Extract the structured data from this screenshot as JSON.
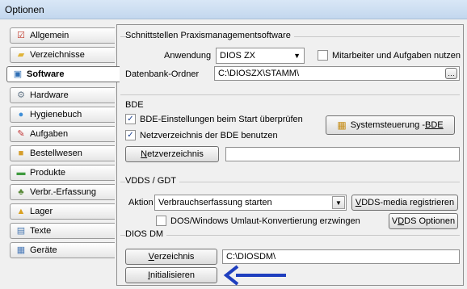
{
  "window": {
    "title": "Optionen"
  },
  "sidebar": {
    "items": [
      {
        "label": "Allgemein",
        "icon": "checklist-icon",
        "glyph": "☑",
        "color": "#c0392b"
      },
      {
        "label": "Verzeichnisse",
        "icon": "folder-icon",
        "glyph": "▰",
        "color": "#e0b43a"
      },
      {
        "label": "Software",
        "icon": "monitor-icon",
        "glyph": "▣",
        "color": "#2f6fb5"
      },
      {
        "label": "Hardware",
        "icon": "gear-icon",
        "glyph": "⚙",
        "color": "#6b7c8c"
      },
      {
        "label": "Hygienebuch",
        "icon": "globe-icon",
        "glyph": "●",
        "color": "#3f8fd8"
      },
      {
        "label": "Aufgaben",
        "icon": "tasks-icon",
        "glyph": "✎",
        "color": "#c03030"
      },
      {
        "label": "Bestellwesen",
        "icon": "box-icon",
        "glyph": "■",
        "color": "#d59d2b"
      },
      {
        "label": "Produkte",
        "icon": "products-icon",
        "glyph": "▬",
        "color": "#3f9a3f"
      },
      {
        "label": "Verbr.-Erfassung",
        "icon": "consumption-icon",
        "glyph": "♣",
        "color": "#5a8a3a"
      },
      {
        "label": "Lager",
        "icon": "warehouse-icon",
        "glyph": "▲",
        "color": "#d9a020"
      },
      {
        "label": "Texte",
        "icon": "document-icon",
        "glyph": "▤",
        "color": "#4a78b0"
      },
      {
        "label": "Geräte",
        "icon": "devices-icon",
        "glyph": "▦",
        "color": "#4a7ab8"
      }
    ],
    "active_index": 2
  },
  "schnittstellen": {
    "group_label": "Schnittstellen Praxismanagementsoftware",
    "anwendung_label": "Anwendung",
    "anwendung_value": "DIOS ZX",
    "mitarbeiter_label": "Mitarbeiter und Aufgaben nutzen",
    "mitarbeiter_checked": false,
    "datenbank_label": "Datenbank-Ordner",
    "datenbank_value": "C:\\DIOSZX\\STAMM\\",
    "browse_label": "…"
  },
  "bde": {
    "group_label": "BDE",
    "check1_label": "BDE-Einstellungen beim Start überprüfen",
    "check1_checked": true,
    "check2_label": "Netzverzeichnis der BDE benutzen",
    "check2_checked": true,
    "systemsteuerung_prefix": "Systemsteuerung - ",
    "systemsteuerung_u": "BDE",
    "netz_u": "N",
    "netz_rest": "etzverzeichnis",
    "netz_value": ""
  },
  "vdds": {
    "group_label": "VDDS / GDT",
    "aktion_label": "Aktion",
    "aktion_value": "Verbrauchserfassung starten",
    "media_u": "V",
    "media_rest": "DDS-media registrieren",
    "umlaut_label": "DOS/Windows Umlaut-Konvertierung erzwingen",
    "umlaut_checked": false,
    "optionen_pre": "V",
    "optionen_u": "D",
    "optionen_rest": "DS Optionen"
  },
  "diosdm": {
    "group_label": "DIOS DM",
    "verzeichnis_u": "V",
    "verzeichnis_rest": "erzeichnis",
    "verzeichnis_value": "C:\\DIOSDM\\",
    "init_u": "I",
    "init_rest": "nitialisieren"
  },
  "annotation": {
    "arrow_color": "#1f3fbf"
  }
}
